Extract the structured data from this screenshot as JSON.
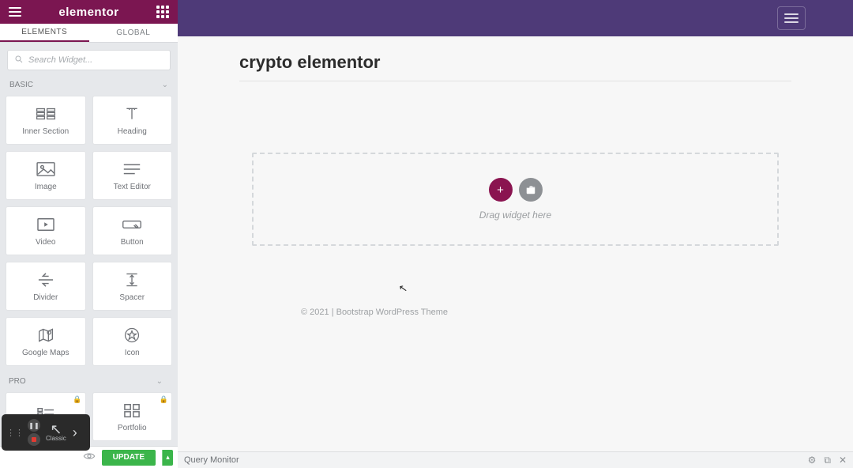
{
  "header": {
    "logo": "elementor"
  },
  "tabs": {
    "elements": "ELEMENTS",
    "global": "GLOBAL"
  },
  "search": {
    "placeholder": "Search Widget..."
  },
  "categories": {
    "basic": "BASIC",
    "pro": "PRO"
  },
  "widgets": {
    "basic": [
      {
        "id": "inner-section",
        "label": "Inner Section"
      },
      {
        "id": "heading",
        "label": "Heading"
      },
      {
        "id": "image",
        "label": "Image"
      },
      {
        "id": "text-editor",
        "label": "Text Editor"
      },
      {
        "id": "video",
        "label": "Video"
      },
      {
        "id": "button",
        "label": "Button"
      },
      {
        "id": "divider",
        "label": "Divider"
      },
      {
        "id": "spacer",
        "label": "Spacer"
      },
      {
        "id": "google-maps",
        "label": "Google Maps"
      },
      {
        "id": "icon",
        "label": "Icon"
      }
    ],
    "pro": [
      {
        "id": "posts",
        "label": ""
      },
      {
        "id": "portfolio",
        "label": "Portfolio"
      }
    ]
  },
  "footer": {
    "update": "UPDATE"
  },
  "recorder": {
    "mode": "Classic",
    "pause": "❚❚"
  },
  "preview": {
    "page_title": "crypto elementor",
    "drop_hint": "Drag widget here",
    "site_footer": "© 2021 | Bootstrap WordPress Theme"
  },
  "status": {
    "label": "Query Monitor"
  }
}
